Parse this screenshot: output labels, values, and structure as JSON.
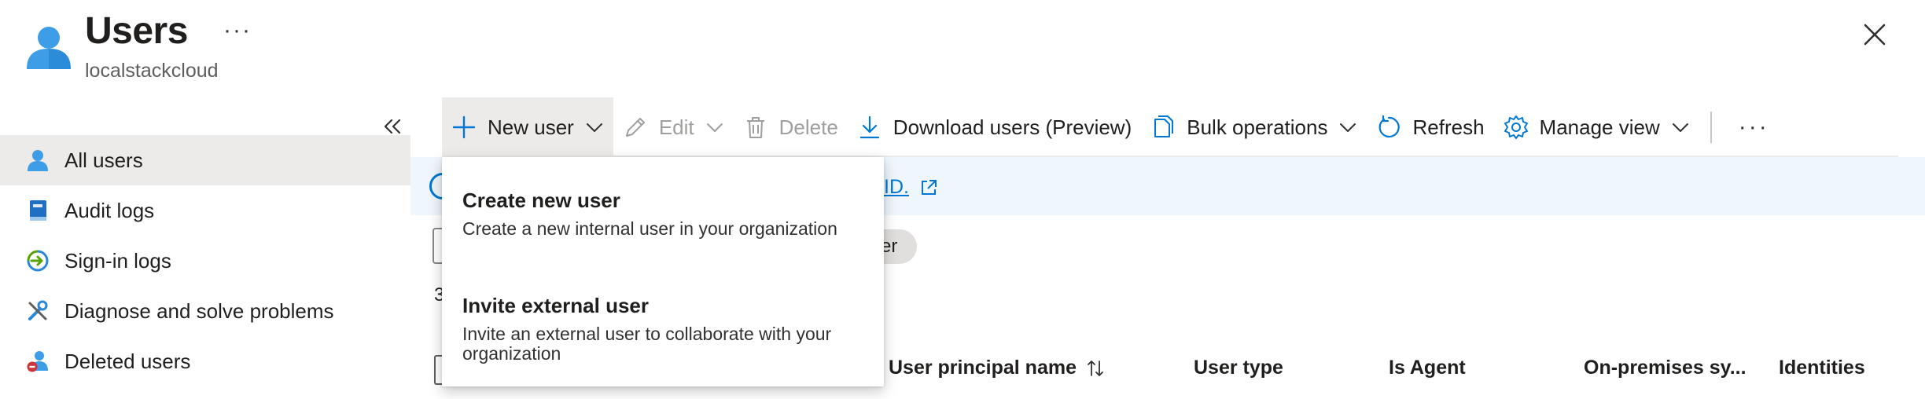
{
  "header": {
    "title": "Users",
    "subtitle": "localstackcloud",
    "more_label": "···"
  },
  "sidebar": {
    "collapse_icon": "double-chevron-left-icon",
    "items": [
      {
        "label": "All users",
        "icon": "user-icon",
        "active": true
      },
      {
        "label": "Audit logs",
        "icon": "book-icon",
        "active": false
      },
      {
        "label": "Sign-in logs",
        "icon": "sign-in-icon",
        "active": false
      },
      {
        "label": "Diagnose and solve problems",
        "icon": "wrench-icon",
        "active": false
      },
      {
        "label": "Deleted users",
        "icon": "deleted-user-icon",
        "active": false
      }
    ]
  },
  "toolbar": {
    "new_user": "New user",
    "edit": "Edit",
    "delete": "Delete",
    "download": "Download users (Preview)",
    "bulk": "Bulk operations",
    "refresh": "Refresh",
    "manage_view": "Manage view",
    "more": "···"
  },
  "banner": {
    "link_fragment": "ID."
  },
  "filters": {
    "pill_fragment": "er",
    "count_fragment": "3"
  },
  "table": {
    "columns": [
      "User principal name",
      "User type",
      "Is Agent",
      "On-premises sy...",
      "Identities"
    ]
  },
  "dropdown": {
    "items": [
      {
        "title": "Create new user",
        "description": "Create a new internal user in your organization"
      },
      {
        "title": "Invite external user",
        "description": "Invite an external user to collaborate with your organization"
      }
    ]
  },
  "colors": {
    "accent": "#0078d4",
    "active_bg": "#edebe9",
    "banner_bg": "#eff6fc",
    "disabled_text": "#a19f9d"
  }
}
